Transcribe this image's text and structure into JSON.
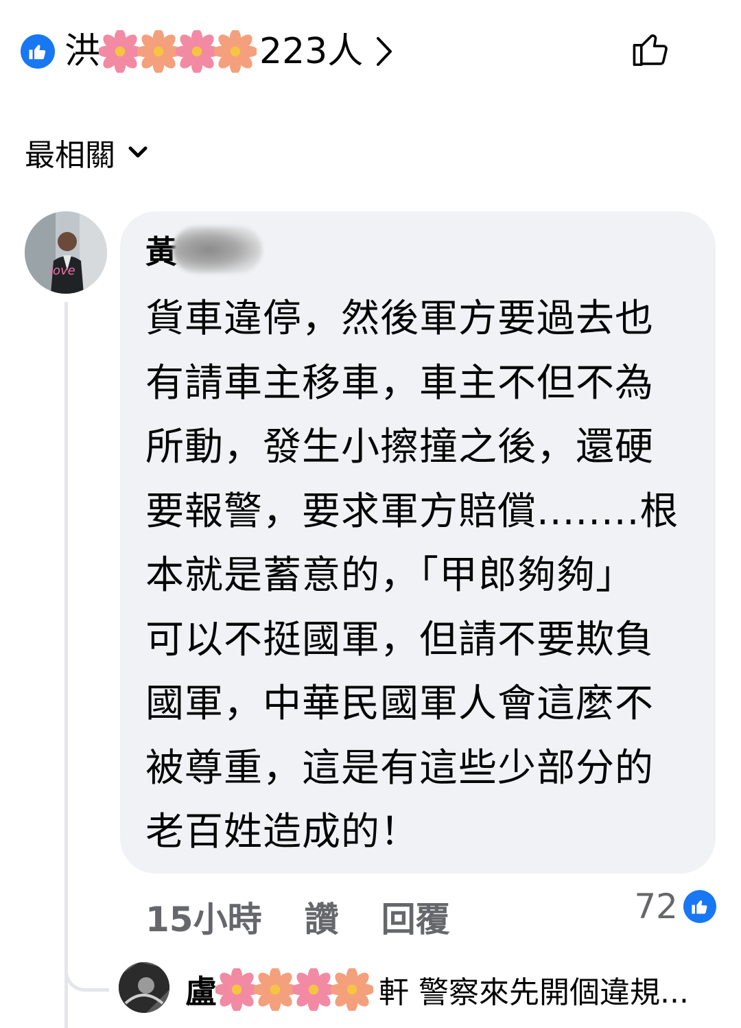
{
  "reactions_bar": {
    "prefix": "洪",
    "suffix": "223人",
    "icon_like": "like-badge-icon",
    "icon_chevron": "chevron-right-icon",
    "icon_like_outline": "like-outline-icon",
    "accent_color": "#1877f2"
  },
  "sort": {
    "label": "最相關",
    "icon": "chevron-down-icon"
  },
  "comment": {
    "author": "黃",
    "lines": [
      "貨車違停，然後軍方要過去也",
      "有請車主移車，車主不但不為",
      "所動，發生小擦撞之後，還硬",
      "要報警，要求軍方賠償........根",
      "本就是蓄意的，「甲郎夠夠」",
      "可以不挺國軍，但請不要欺負",
      "國軍，中華民國軍人會這麼不",
      "被尊重，這是有這些少部分的",
      "老百姓造成的！"
    ],
    "time": "15小時",
    "like_label": "讚",
    "reply_label": "回覆",
    "like_count": "72"
  },
  "reply_preview": {
    "author": "盧",
    "text": "軒 警察來先開個違規..."
  },
  "colors": {
    "bubble_bg": "#f0f2f5",
    "meta_text": "#65676b",
    "thread_line": "#e4e6eb"
  }
}
